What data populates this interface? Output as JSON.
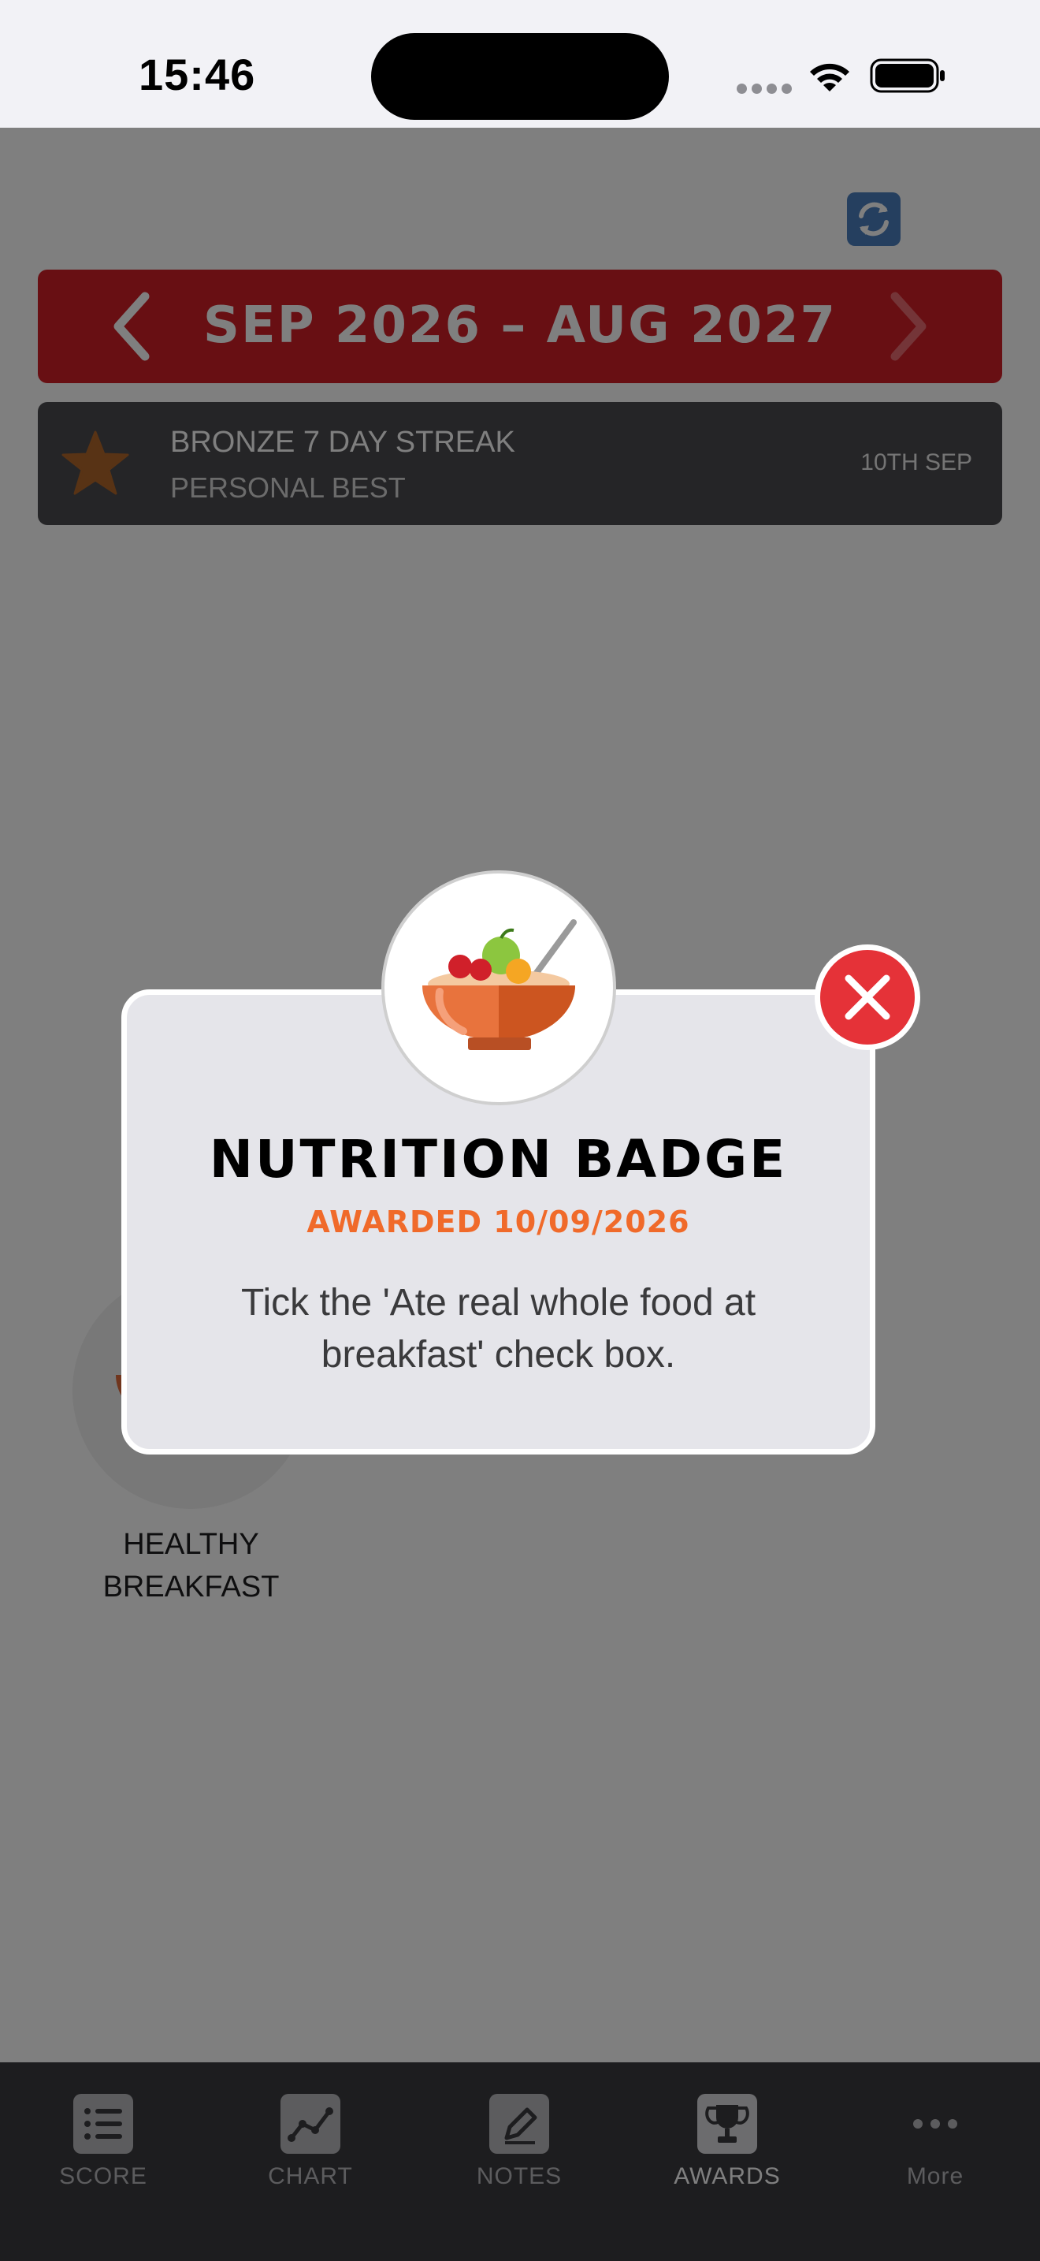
{
  "status_bar": {
    "time": "15:46"
  },
  "header": {
    "sync_icon": "sync-icon"
  },
  "period": {
    "label": "SEP 2026 – AUG 2027",
    "prev_icon": "chevron-left-icon",
    "next_icon": "chevron-right-icon"
  },
  "awards": [
    {
      "title": "BRONZE 7 DAY STREAK",
      "subtitle": "PERSONAL BEST",
      "date": "10TH SEP",
      "icon": "bronze-star-icon"
    }
  ],
  "badges": [
    {
      "label_line1": "HEALTHY",
      "label_line2": "BREAKFAST",
      "icon": "breakfast-bowl-icon"
    }
  ],
  "modal": {
    "icon": "fruit-bowl-icon",
    "title": "NUTRITION BADGE",
    "awarded": "AWARDED 10/09/2026",
    "description": "Tick the 'Ate real whole food at breakfast' check box.",
    "close_icon": "close-icon"
  },
  "tabs": [
    {
      "label": "SCORE",
      "icon": "list-icon",
      "active": false
    },
    {
      "label": "CHART",
      "icon": "chart-icon",
      "active": false
    },
    {
      "label": "NOTES",
      "icon": "pencil-icon",
      "active": false
    },
    {
      "label": "AWARDS",
      "icon": "trophy-icon",
      "active": true
    },
    {
      "label": "More",
      "icon": "more-icon",
      "active": false
    }
  ],
  "colors": {
    "accent_red": "#d11f26",
    "award_orange": "#f06a2a",
    "close_red": "#e53238",
    "bronze": "#b0662a"
  }
}
